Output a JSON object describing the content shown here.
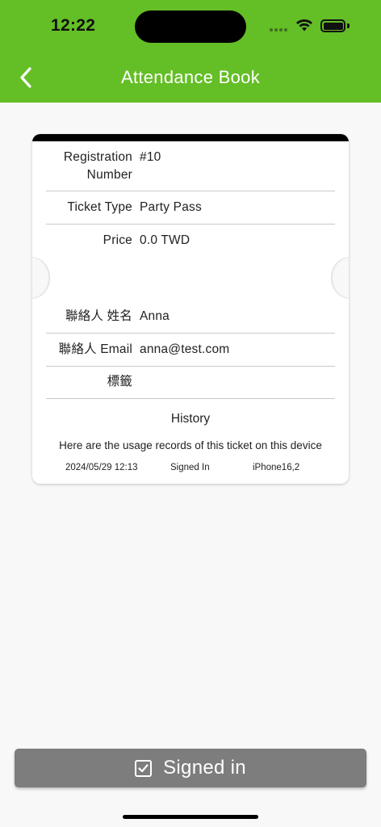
{
  "status_bar": {
    "time": "12:22"
  },
  "header": {
    "title": "Attendance Book",
    "back_icon": "chevron-left-icon",
    "color": "#64be26"
  },
  "ticket": {
    "fields": [
      {
        "label": "Registration Number",
        "value": "#10"
      },
      {
        "label": "Ticket Type",
        "value": "Party Pass"
      },
      {
        "label": "Price",
        "value": "0.0 TWD"
      },
      {
        "label": "聯絡人 姓名",
        "value": "Anna"
      },
      {
        "label": "聯絡人 Email",
        "value": "anna@test.com"
      },
      {
        "label": "標籤",
        "value": ""
      }
    ],
    "history": {
      "title": "History",
      "description": "Here are the usage records of this ticket on this device",
      "records": [
        {
          "datetime": "2024/05/29 12:13",
          "action": "Signed In",
          "device": "iPhone16,2"
        }
      ]
    }
  },
  "signin_button": {
    "label": "Signed in",
    "icon": "checkbox-checked-icon",
    "color": "#7d7d7d"
  }
}
